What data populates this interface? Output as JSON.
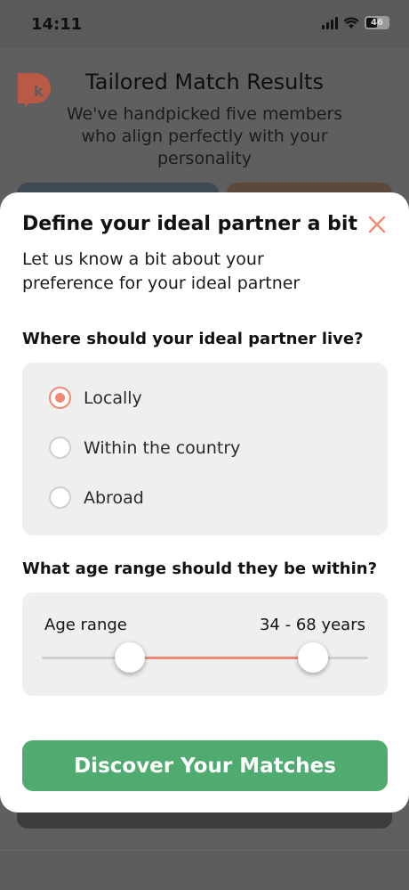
{
  "status_bar": {
    "time": "14:11",
    "battery": "46",
    "icons": [
      "signal-icon",
      "wifi-icon",
      "battery-icon"
    ]
  },
  "background": {
    "title": "Tailored Match Results",
    "subtitle": "We've handpicked five members who align perfectly with your personality",
    "logo_letter": "k",
    "logo_color": "#b85a45"
  },
  "sheet": {
    "title": "Define your ideal partner a bit",
    "description": "Let us know a bit about your preference for your ideal partner",
    "close_icon": "close-icon",
    "location": {
      "question": "Where should your ideal partner live?",
      "options": [
        {
          "label": "Locally",
          "checked": true
        },
        {
          "label": "Within the country",
          "checked": false
        },
        {
          "label": "Abroad",
          "checked": false
        }
      ]
    },
    "age": {
      "question": "What age range should they be within?",
      "label": "Age range",
      "value_text": "34 - 68 years",
      "min_age": 34,
      "max_age": 68,
      "thumb_low_fraction": 0.27,
      "thumb_high_fraction": 0.83
    },
    "cta_label": "Discover Your Matches",
    "accent_color": "#f08a73",
    "cta_color": "#4fab70"
  }
}
